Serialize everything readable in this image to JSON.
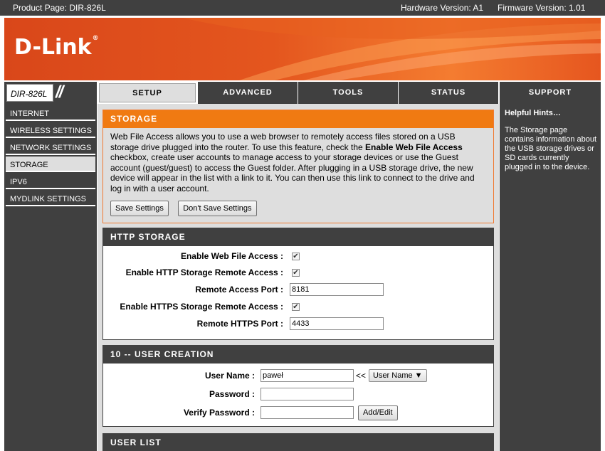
{
  "topbar": {
    "product": "Product Page: DIR-826L",
    "hardware": "Hardware Version: A1",
    "firmware": "Firmware Version: 1.01"
  },
  "brand": {
    "logo": "D-Link",
    "trademark": "®"
  },
  "model": "DIR-826L",
  "tabs": [
    {
      "label": "SETUP",
      "active": true
    },
    {
      "label": "ADVANCED"
    },
    {
      "label": "TOOLS"
    },
    {
      "label": "STATUS"
    },
    {
      "label": "SUPPORT"
    }
  ],
  "sidebar": {
    "items": [
      {
        "label": "INTERNET"
      },
      {
        "label": "WIRELESS SETTINGS"
      },
      {
        "label": "NETWORK SETTINGS"
      },
      {
        "label": "STORAGE",
        "active": true
      },
      {
        "label": "IPV6"
      },
      {
        "label": "MYDLINK SETTINGS"
      }
    ]
  },
  "storage": {
    "title": "STORAGE",
    "desc_before": "Web File Access allows you to use a web browser to remotely access files stored on a USB storage drive plugged into the router. To use this feature, check the ",
    "desc_bold": "Enable Web File Access",
    "desc_after": " checkbox, create user accounts to manage access to your storage devices or use the Guest account (guest/guest) to access the Guest folder. After plugging in a USB storage drive, the new device will appear in the list with a link to it. You can then use this link to connect to the drive and log in with a user account.",
    "save_label": "Save Settings",
    "dont_save_label": "Don't Save Settings"
  },
  "http_storage": {
    "title": "HTTP STORAGE",
    "enable_web_file_access": "Enable Web File Access :",
    "enable_http_remote": "Enable HTTP Storage Remote Access :",
    "remote_port_label": "Remote Access Port :",
    "remote_port_value": "8181",
    "enable_https_remote": "Enable HTTPS Storage Remote Access :",
    "https_port_label": "Remote HTTPS Port :",
    "https_port_value": "4433",
    "checked": true
  },
  "user_creation": {
    "title": "10 -- USER CREATION",
    "username_label": "User Name :",
    "username_value": "paweł",
    "arrow": "<<",
    "select_label": "User Name ▼",
    "password_label": "Password :",
    "verify_label": "Verify Password :",
    "add_edit_label": "Add/Edit"
  },
  "user_list": {
    "title": "USER LIST"
  },
  "hints": {
    "title": "Helpful Hints…",
    "text": "The Storage page contains information about the USB storage drives or SD cards currently plugged in to the device."
  },
  "colors": {
    "dark": "#404040",
    "orange": "#f07a12",
    "panel_bg": "#dedede"
  }
}
